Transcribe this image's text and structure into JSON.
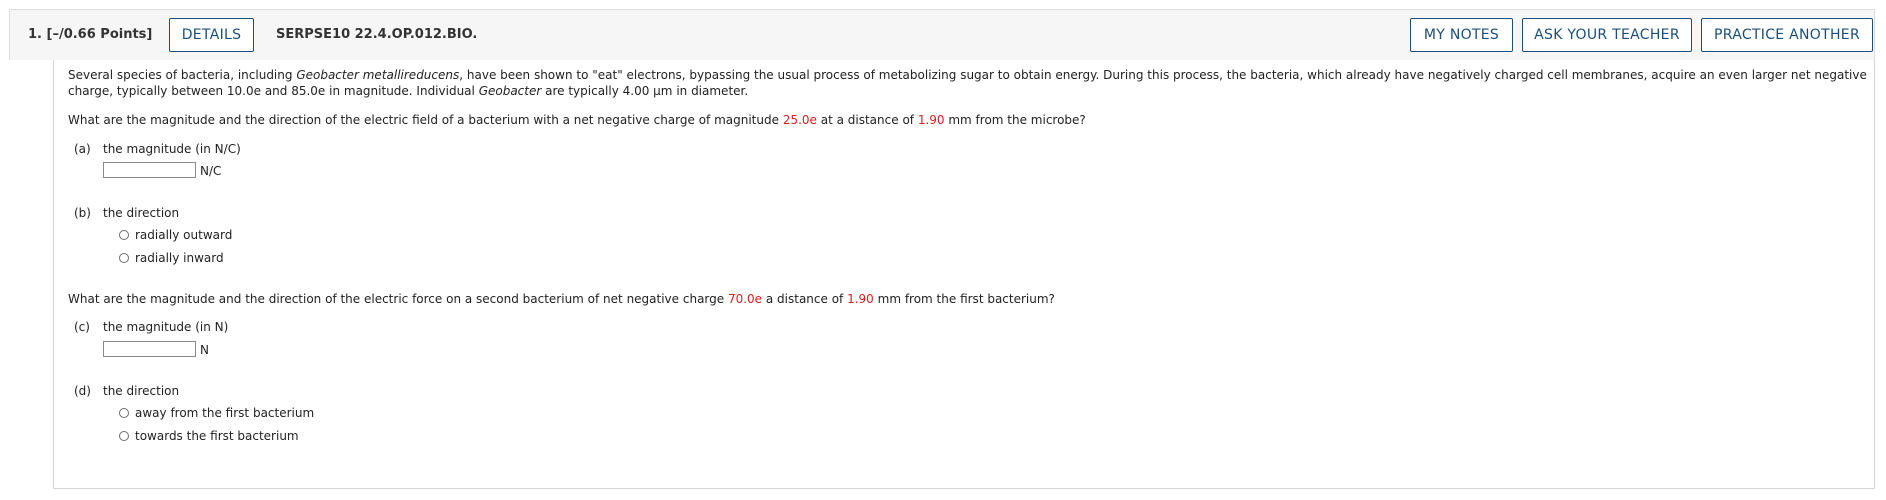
{
  "header": {
    "number_points": "1.  [–/0.66 Points]",
    "details_label": "DETAILS",
    "code": "SERPSE10 22.4.OP.012.BIO.",
    "my_notes_label": "MY NOTES",
    "ask_teacher_label": "ASK YOUR TEACHER",
    "practice_label": "PRACTICE ANOTHER"
  },
  "intro": {
    "l1_a": "Several species of bacteria, including ",
    "l1_b": "Geobacter metallireducens",
    "l1_c": ", have been shown to \"eat\" electrons, bypassing the usual process of metabolizing sugar to obtain energy. During this process, the bacteria, which already have negatively charged cell membranes, acquire an even larger net negative",
    "l2_a": "charge, typically between 10.0e and 85.0e in magnitude. Individual ",
    "l2_b": "Geobacter",
    "l2_c": " are typically 4.00 µm in diameter."
  },
  "q1": {
    "a": "What are the magnitude and the direction of the electric field of a bacterium with a net negative charge of magnitude ",
    "charge": "25.0e",
    "b": " at a distance of ",
    "dist": "1.90",
    "c": " mm from the microbe?"
  },
  "part_a": {
    "tag": "(a)",
    "label": "the magnitude (in N/C)",
    "value": "",
    "unit": "N/C"
  },
  "part_b": {
    "tag": "(b)",
    "label": "the direction",
    "options": [
      "radially outward",
      "radially inward"
    ]
  },
  "q2": {
    "a": "What are the magnitude and the direction of the electric force on a second bacterium of net negative charge ",
    "charge": "70.0e",
    "b": " a distance of ",
    "dist": "1.90",
    "c": " mm from the first bacterium?"
  },
  "part_c": {
    "tag": "(c)",
    "label": "the magnitude (in N)",
    "value": "",
    "unit": "N"
  },
  "part_d": {
    "tag": "(d)",
    "label": "the direction",
    "options": [
      "away from the first bacterium",
      "towards the first bacterium"
    ]
  }
}
